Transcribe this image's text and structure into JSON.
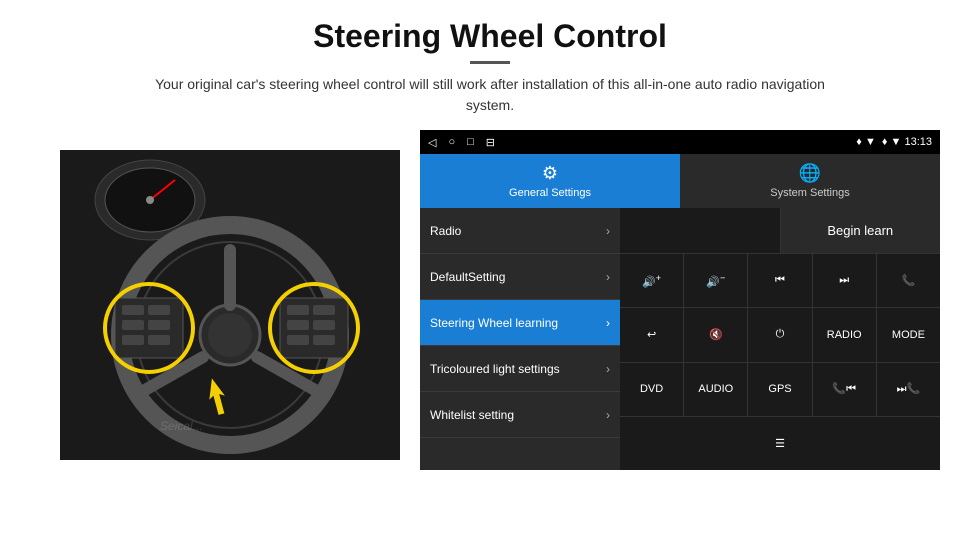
{
  "header": {
    "title": "Steering Wheel Control",
    "subtitle": "Your original car's steering wheel control will still work after installation of this all-in-one auto radio navigation system."
  },
  "android": {
    "status_bar": {
      "nav_icons": [
        "◁",
        "○",
        "□",
        "⊟"
      ],
      "right": "♦ ▼  13:13"
    },
    "tabs": [
      {
        "label": "General Settings",
        "icon": "⚙",
        "active": true
      },
      {
        "label": "System Settings",
        "icon": "🌐",
        "active": false
      }
    ],
    "menu_items": [
      {
        "label": "Radio",
        "active": false
      },
      {
        "label": "DefaultSetting",
        "active": false
      },
      {
        "label": "Steering Wheel learning",
        "active": true
      },
      {
        "label": "Tricoloured light settings",
        "active": false
      },
      {
        "label": "Whitelist setting",
        "active": false
      }
    ],
    "right_panel": {
      "begin_learn_label": "Begin learn",
      "control_rows": [
        [
          {
            "icon": "🔊+",
            "label": ""
          },
          {
            "icon": "🔊−",
            "label": ""
          },
          {
            "icon": "⏮",
            "label": ""
          },
          {
            "icon": "⏭",
            "label": ""
          },
          {
            "icon": "📞",
            "label": ""
          }
        ],
        [
          {
            "icon": "↩",
            "label": ""
          },
          {
            "icon": "🔇",
            "label": ""
          },
          {
            "icon": "⏻",
            "label": ""
          },
          {
            "icon": "",
            "label": "RADIO"
          },
          {
            "icon": "",
            "label": "MODE"
          }
        ],
        [
          {
            "icon": "",
            "label": "DVD"
          },
          {
            "icon": "",
            "label": "AUDIO"
          },
          {
            "icon": "",
            "label": "GPS"
          },
          {
            "icon": "📞⏮",
            "label": ""
          },
          {
            "icon": "⏭📞",
            "label": ""
          }
        ],
        [
          {
            "icon": "☰",
            "label": ""
          }
        ]
      ]
    }
  }
}
